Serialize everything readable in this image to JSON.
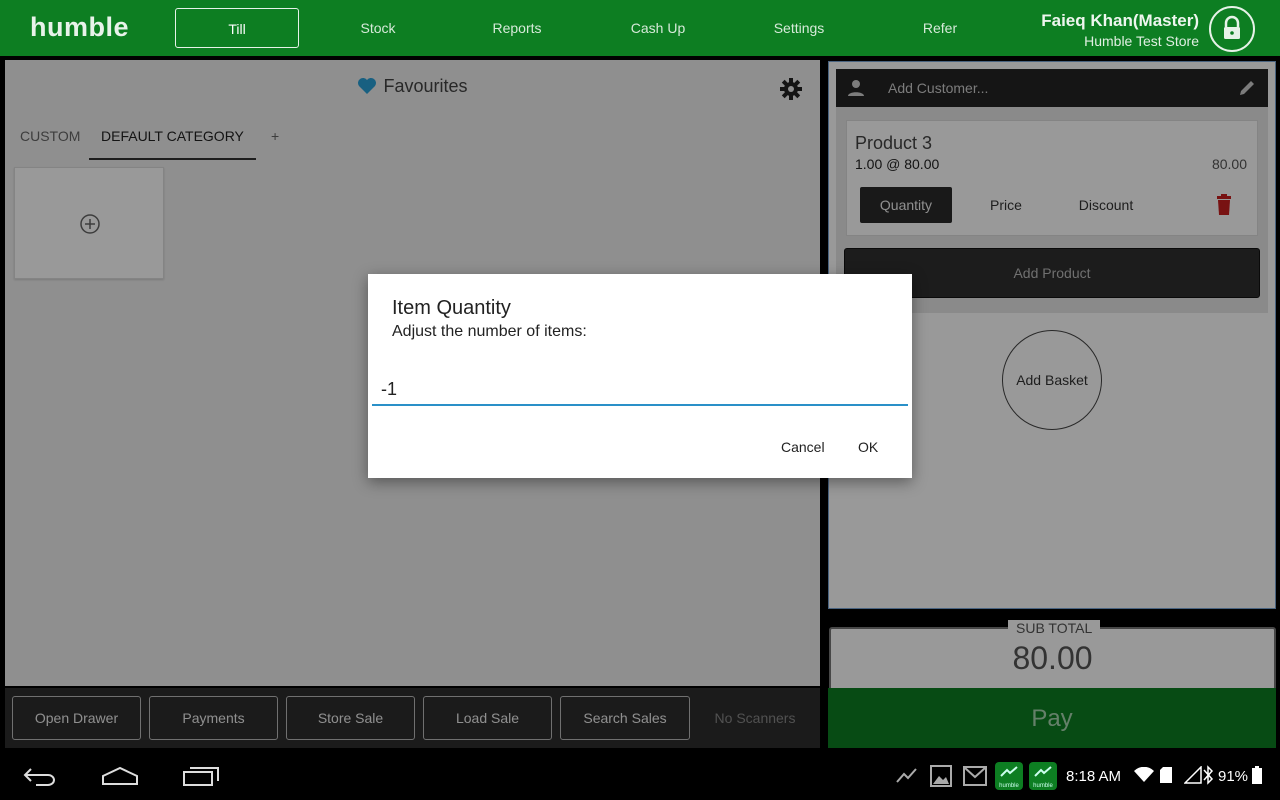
{
  "app": {
    "logo": "humble"
  },
  "nav": {
    "items": [
      {
        "label": "Till",
        "active": true
      },
      {
        "label": "Stock",
        "active": false
      },
      {
        "label": "Reports",
        "active": false
      },
      {
        "label": "Cash Up",
        "active": false
      },
      {
        "label": "Settings",
        "active": false
      },
      {
        "label": "Refer",
        "active": false
      }
    ],
    "user_name": "Faieq Khan(Master)",
    "store_name": "Humble Test Store"
  },
  "favourites": {
    "title": "Favourites",
    "tabs": [
      "CUSTOM",
      "DEFAULT CATEGORY",
      "+"
    ],
    "active_tab": "DEFAULT CATEGORY"
  },
  "actions": {
    "buttons": [
      "Open Drawer",
      "Payments",
      "Store Sale",
      "Load Sale",
      "Search Sales"
    ],
    "status": "No Scanners"
  },
  "basket": {
    "customer_placeholder": "Add Customer...",
    "item": {
      "name": "Product 3",
      "qty_line": "1.00 @ 80.00",
      "line_total": "80.00",
      "buttons": [
        "Quantity",
        "Price",
        "Discount"
      ]
    },
    "add_product": "Add Product",
    "add_basket": "Add Basket",
    "subtotal_label": "SUB TOTAL",
    "subtotal_value": "80.00",
    "pay": "Pay"
  },
  "dialog": {
    "title": "Item Quantity",
    "message": "Adjust the number of items:",
    "input_value": "-1",
    "cancel": "Cancel",
    "ok": "OK"
  },
  "system": {
    "time": "8:18 AM",
    "battery": "91%",
    "app_label": "humble"
  },
  "colors": {
    "brand_green": "#0d7e22",
    "input_accent": "#2a90c8",
    "delete_red": "#c81e1e",
    "heart_blue": "#29a0d8"
  }
}
